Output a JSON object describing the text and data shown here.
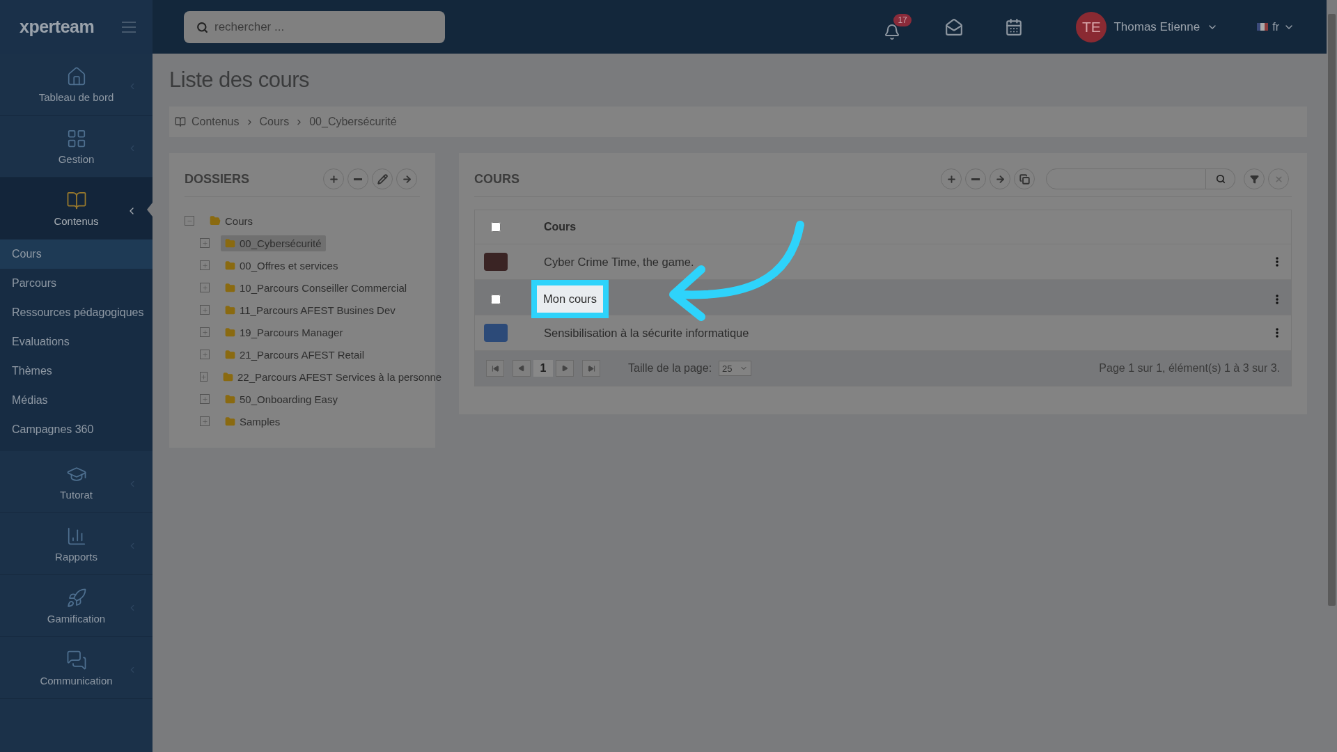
{
  "header": {
    "logo": "xperteam",
    "search": {
      "placeholder": "rechercher ..."
    },
    "notifications": {
      "count": "17"
    },
    "user": {
      "initials": "TE",
      "name": "Thomas Etienne"
    },
    "language": "fr"
  },
  "sidebar": {
    "items": [
      {
        "label": "Tableau de bord",
        "selected": false,
        "expanded": false
      },
      {
        "label": "Gestion",
        "selected": false,
        "expanded": false
      },
      {
        "label": "Contenus",
        "selected": true,
        "expanded": true,
        "children": [
          {
            "label": "Cours",
            "selected": true
          },
          {
            "label": "Parcours",
            "selected": false
          },
          {
            "label": "Ressources pédagogiques",
            "selected": false
          },
          {
            "label": "Evaluations",
            "selected": false
          },
          {
            "label": "Thèmes",
            "selected": false
          },
          {
            "label": "Médias",
            "selected": false
          },
          {
            "label": "Campagnes 360",
            "selected": false
          }
        ]
      },
      {
        "label": "Tutorat",
        "selected": false,
        "expanded": false
      },
      {
        "label": "Rapports",
        "selected": false,
        "expanded": false
      },
      {
        "label": "Gamification",
        "selected": false,
        "expanded": false
      },
      {
        "label": "Communication",
        "selected": false,
        "expanded": false
      }
    ]
  },
  "page_title": "Liste des cours",
  "breadcrumb": [
    "Contenus",
    "Cours",
    "00_Cybersécurité"
  ],
  "folders": {
    "title": "DOSSIERS",
    "tree": {
      "label": "Cours",
      "expanded": true,
      "children": [
        {
          "label": "00_Cybersécurité",
          "selected": true
        },
        {
          "label": "00_Offres et services",
          "selected": false
        },
        {
          "label": "10_Parcours Conseiller Commercial",
          "selected": false
        },
        {
          "label": "11_Parcours AFEST Busines Dev",
          "selected": false
        },
        {
          "label": "19_Parcours Manager",
          "selected": false
        },
        {
          "label": "21_Parcours AFEST Retail",
          "selected": false
        },
        {
          "label": "22_Parcours AFEST Services à la personne",
          "selected": false
        },
        {
          "label": "50_Onboarding Easy",
          "selected": false
        },
        {
          "label": "Samples",
          "selected": false
        }
      ]
    }
  },
  "courses": {
    "title": "COURS",
    "column": "Cours",
    "all_checked": false,
    "rows": [
      {
        "kind": "thumbnail",
        "title": "Cyber Crime Time, the game.",
        "highlighted": false
      },
      {
        "kind": "checkbox",
        "title": "Mon cours",
        "checked": false,
        "highlighted": true
      },
      {
        "kind": "thumbnail",
        "title": "Sensibilisation à la sécurite informatique",
        "highlighted": false
      }
    ],
    "pager": {
      "page": "1",
      "size_label": "Taille de la page:",
      "page_size": "25",
      "summary": "Page 1 sur 1, élément(s) 1 à 3 sur 3."
    }
  }
}
